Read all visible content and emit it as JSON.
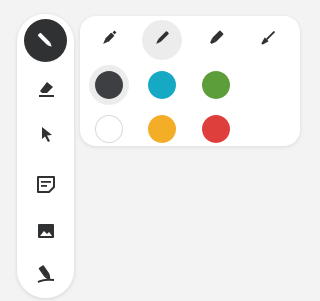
{
  "toolbar": {
    "tools": [
      {
        "name": "pen-tool",
        "icon": "pen-icon",
        "active": true
      },
      {
        "name": "eraser-tool",
        "icon": "eraser-icon",
        "active": false
      },
      {
        "name": "select-tool",
        "icon": "cursor-arrow-icon",
        "active": false
      },
      {
        "name": "sticky-note-tool",
        "icon": "note-icon",
        "active": false
      },
      {
        "name": "image-tool",
        "icon": "image-icon",
        "active": false
      },
      {
        "name": "highlighter-tool",
        "icon": "highlighter-icon",
        "active": false
      }
    ]
  },
  "pen_panel": {
    "pen_styles": [
      {
        "name": "fine-tip-pen",
        "icon": "fine-pen-icon",
        "selected": false
      },
      {
        "name": "ballpoint-pen",
        "icon": "ballpoint-pen-icon",
        "selected": true
      },
      {
        "name": "marker-pen",
        "icon": "marker-pen-icon",
        "selected": false
      },
      {
        "name": "brush-pen",
        "icon": "brush-pen-icon",
        "selected": false
      }
    ],
    "colors": [
      {
        "name": "color-dark-gray",
        "hex": "#3d3f42",
        "selected": true
      },
      {
        "name": "color-cyan",
        "hex": "#16a9c4",
        "selected": false
      },
      {
        "name": "color-green",
        "hex": "#5c9e3a",
        "selected": false
      },
      {
        "name": "color-white",
        "hex": "#ffffff",
        "selected": false
      },
      {
        "name": "color-yellow",
        "hex": "#f3ad27",
        "selected": false
      },
      {
        "name": "color-red",
        "hex": "#de3f3c",
        "selected": false
      }
    ]
  }
}
